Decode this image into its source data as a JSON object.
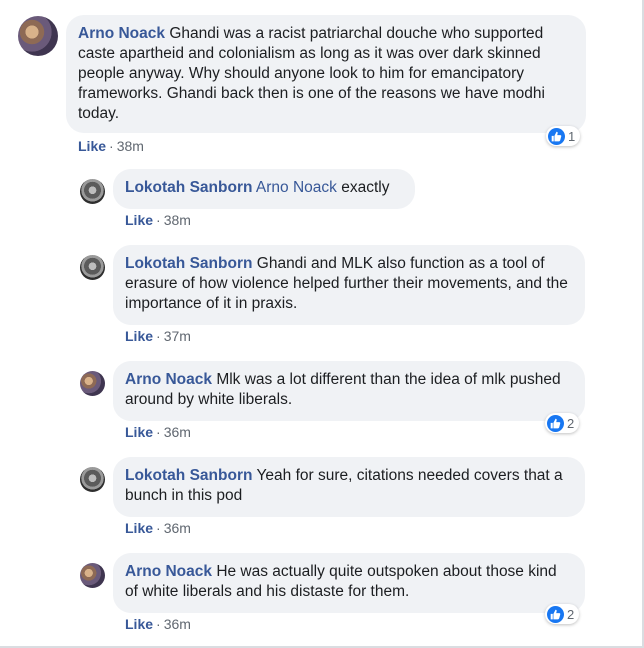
{
  "comments": [
    {
      "author": "Arno Noack",
      "mention": "",
      "text": "Ghandi was a racist patriarchal douche who supported caste apartheid and colonialism as long as it was over dark skinned people anyway. Why should anyone look to him for emancipatory frameworks. Ghandi back then is one of the reasons we have modhi today.",
      "like_label": "Like",
      "time": "38m",
      "reactions": "1"
    },
    {
      "author": "Lokotah Sanborn",
      "mention": "Arno Noack",
      "text": "exactly",
      "like_label": "Like",
      "time": "38m"
    },
    {
      "author": "Lokotah Sanborn",
      "mention": "",
      "text": "Ghandi and MLK also function as a tool of erasure of how violence helped further their movements, and the importance of it in praxis.",
      "like_label": "Like",
      "time": "37m"
    },
    {
      "author": "Arno Noack",
      "mention": "",
      "text": "Mlk was a lot different than the idea of mlk pushed around by white liberals.",
      "like_label": "Like",
      "time": "36m",
      "reactions": "2"
    },
    {
      "author": "Lokotah Sanborn",
      "mention": "",
      "text": "Yeah for sure, citations needed covers that a bunch in this pod",
      "like_label": "Like",
      "time": "36m"
    },
    {
      "author": "Arno Noack",
      "mention": "",
      "text": "He was actually quite outspoken about those kind of white liberals and his distaste for them.",
      "like_label": "Like",
      "time": "36m",
      "reactions": "2"
    }
  ],
  "separator": "·",
  "reaction_icon": "thumbs-up-icon",
  "colors": {
    "author": "#385898",
    "bubble": "#f0f2f5",
    "reaction_blue": "#1877f2",
    "meta": "#606770"
  }
}
